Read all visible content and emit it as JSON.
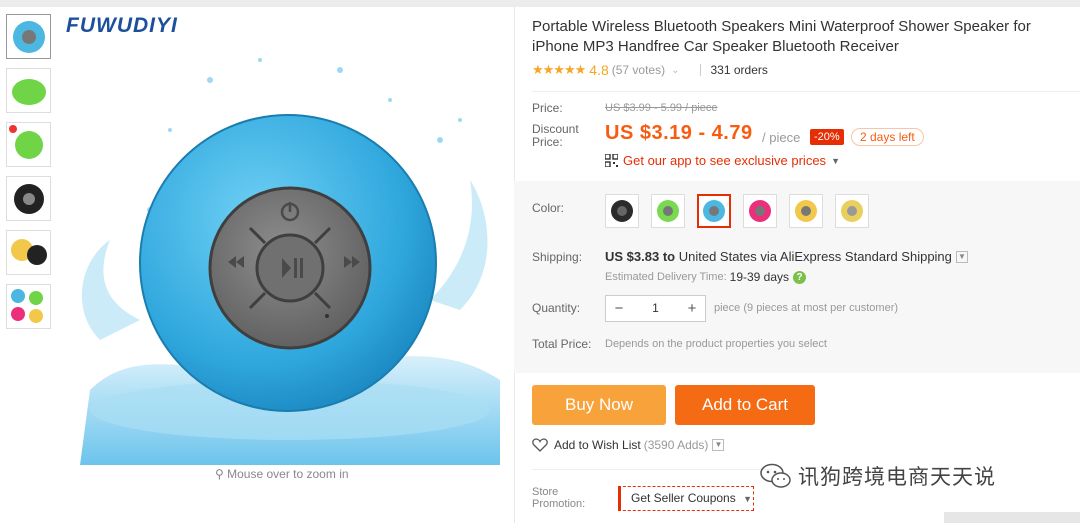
{
  "brand": "FUWUDIYI",
  "title": "Portable Wireless Bluetooth Speakers Mini Waterproof Shower Speaker for iPhone MP3 Handfree Car Speaker Bluetooth Receiver",
  "rating": {
    "stars": "★★★★★",
    "value": "4.8",
    "votes": "(57 votes)",
    "orders": "331 orders"
  },
  "price": {
    "label": "Price:",
    "original": "US $3.99 - 5.99 / piece",
    "discount_label": "Discount Price:",
    "current": "US $3.19 - 4.79",
    "per": "/ piece",
    "discount_badge": "-20%",
    "days_left": "2 days left",
    "app_promo": "Get our app to see exclusive prices"
  },
  "color": {
    "label": "Color:",
    "options": [
      "black",
      "green",
      "blue",
      "pink",
      "yellow",
      "yellow-grey"
    ],
    "selected": "blue",
    "swatch_colors": [
      "#2b2b2b",
      "#79d94f",
      "#4cb7e0",
      "#ec2f7b",
      "#f1c84a",
      "#e8cf5e"
    ]
  },
  "shipping": {
    "label": "Shipping:",
    "price": "US $3.83",
    "to": "to",
    "destination": "United States via AliExpress Standard Shipping",
    "delivery_label": "Estimated Delivery Time:",
    "delivery_days": "19-39 days"
  },
  "quantity": {
    "label": "Quantity:",
    "minus": "−",
    "value": "1",
    "plus": "+",
    "note": "piece (9 pieces at most per customer)"
  },
  "total": {
    "label": "Total Price:",
    "note": "Depends on the product properties you select"
  },
  "actions": {
    "buy_now": "Buy Now",
    "add_to_cart": "Add to Cart",
    "wish_list": "Add to Wish List",
    "wish_count": "(3590 Adds)"
  },
  "store": {
    "label": "Store Promotion:",
    "coupon": "Get Seller Coupons"
  },
  "zoom_hint": "Mouse over to zoom in",
  "watermark": "讯狗跨境电商天天说",
  "accent_colors": {
    "price_orange": "#f75c10",
    "buy_now": "#f7a23a",
    "add_to_cart": "#f56b14",
    "discount_red": "#e62e04",
    "star": "#f5a623"
  }
}
